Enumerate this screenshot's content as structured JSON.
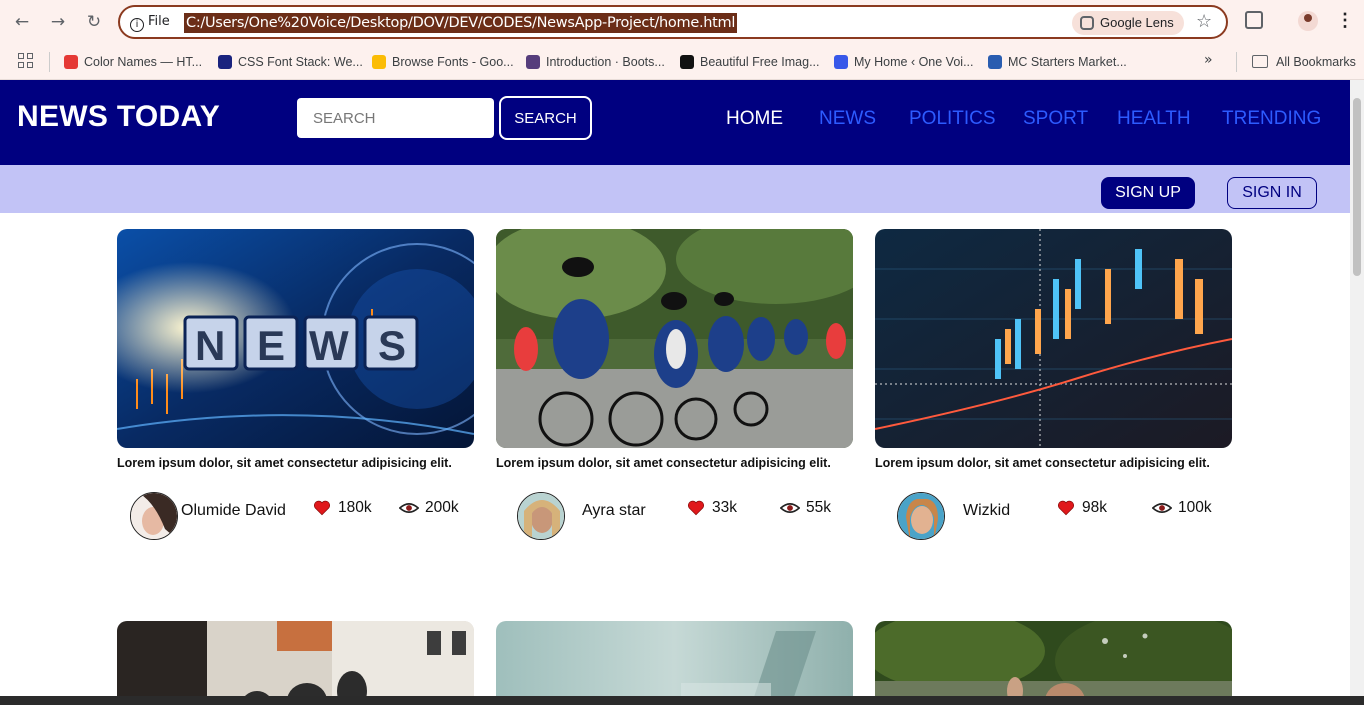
{
  "browser": {
    "file_label": "File",
    "url": "C:/Users/One%20Voice/Desktop/DOV/DEV/CODES/NewsApp-Project/home.html",
    "lens_label": "Google Lens",
    "bookmarks": [
      {
        "label": "Color Names — HT...",
        "color": "#e53935"
      },
      {
        "label": "CSS Font Stack: We...",
        "color": "#1a237e"
      },
      {
        "label": "Browse Fonts - Goo...",
        "color": "#fbbc05"
      },
      {
        "label": "Introduction · Boots...",
        "color": "#563d7c"
      },
      {
        "label": "Beautiful Free Imag...",
        "color": "#111111"
      },
      {
        "label": "My Home ‹ One Voi...",
        "color": "#3858e9"
      },
      {
        "label": "MC Starters Market...",
        "color": "#2a5db0"
      }
    ],
    "all_bookmarks": "All Bookmarks"
  },
  "header": {
    "logo": "NEWS TODAY",
    "search_placeholder": "SEARCH",
    "search_button": "SEARCH",
    "nav": [
      "HOME",
      "NEWS",
      "POLITICS",
      "SPORT",
      "HEALTH",
      "TRENDING"
    ],
    "active_nav": "HOME"
  },
  "auth": {
    "signup": "SIGN UP",
    "signin": "SIGN IN"
  },
  "cards": [
    {
      "title": "Lorem ipsum dolor, sit amet consectetur adipisicing elit.",
      "author": "Olumide David",
      "likes": "180k",
      "views": "200k",
      "image": "news-globe"
    },
    {
      "title": "Lorem ipsum dolor, sit amet consectetur adipisicing elit.",
      "author": "Ayra star",
      "likes": "33k",
      "views": "55k",
      "image": "cyclists"
    },
    {
      "title": "Lorem ipsum dolor, sit amet consectetur adipisicing elit.",
      "author": "Wizkid",
      "likes": "98k",
      "views": "100k",
      "image": "stock-chart"
    }
  ],
  "colors": {
    "brand_navy": "#000080",
    "nav_link": "#2d5bff",
    "auth_bar": "#c2c3f6",
    "heart": "#e0181b"
  }
}
